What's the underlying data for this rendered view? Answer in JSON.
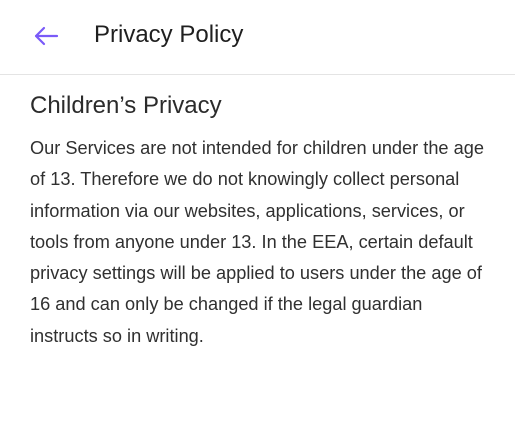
{
  "app_bar": {
    "back_icon": "arrow-left-icon",
    "back_icon_color": "#7a5af8",
    "title": "Privacy Policy"
  },
  "section": {
    "heading": "Children’s Privacy",
    "body": "Our Services are not intended for children under the age of 13. Therefore we do not knowingly collect personal information via our websites, applications, services, or tools from anyone under 13. In the EEA, certain default privacy settings will be applied to users under the age of 16 and can only be changed if the legal guardian instructs so in writing."
  }
}
